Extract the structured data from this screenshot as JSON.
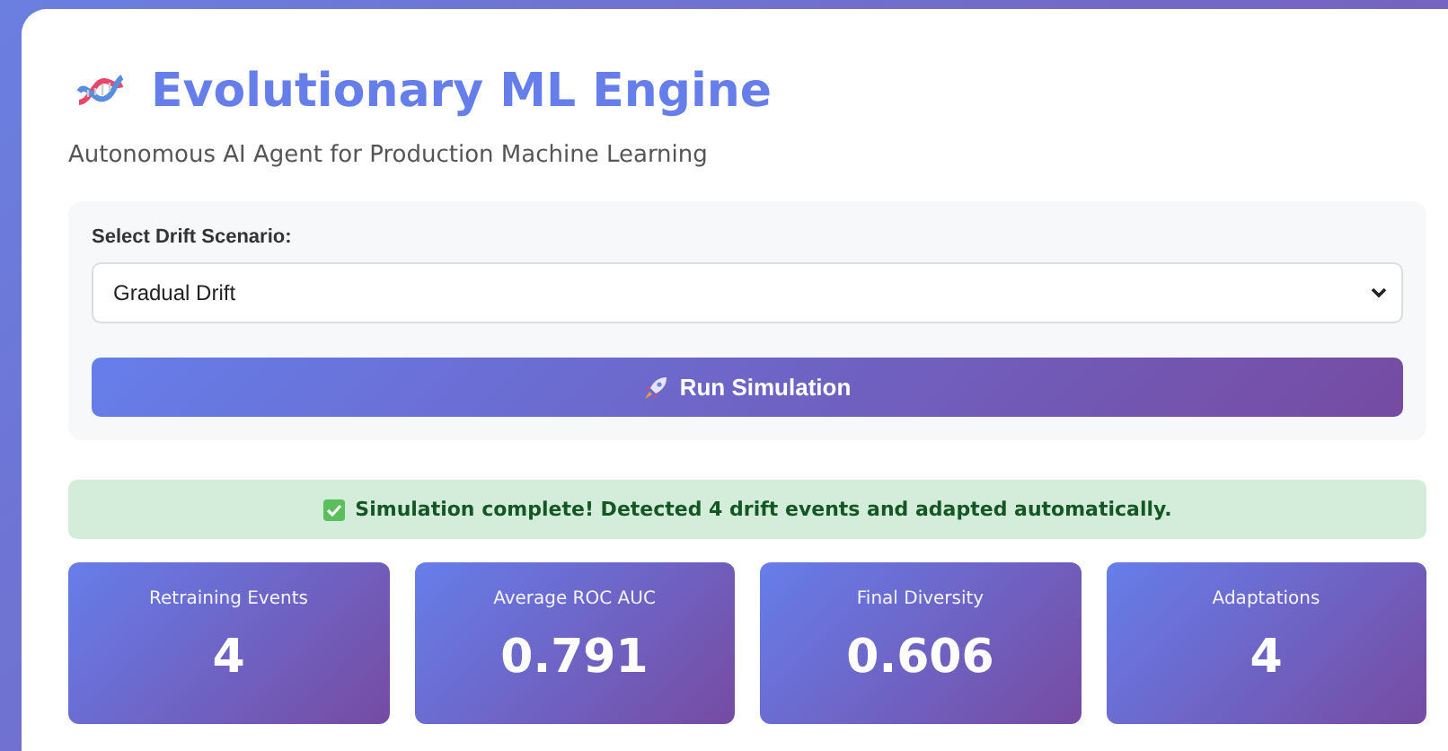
{
  "header": {
    "title": "Evolutionary ML Engine",
    "subtitle": "Autonomous AI Agent for Production Machine Learning"
  },
  "controls": {
    "scenario_label": "Select Drift Scenario:",
    "scenario_value": "Gradual Drift",
    "run_button": "Run Simulation"
  },
  "alert": {
    "text": "Simulation complete! Detected 4 drift events and adapted automatically."
  },
  "metrics": [
    {
      "label": "Retraining Events",
      "value": "4"
    },
    {
      "label": "Average ROC AUC",
      "value": "0.791"
    },
    {
      "label": "Final Diversity",
      "value": "0.606"
    },
    {
      "label": "Adaptations",
      "value": "4"
    }
  ]
}
